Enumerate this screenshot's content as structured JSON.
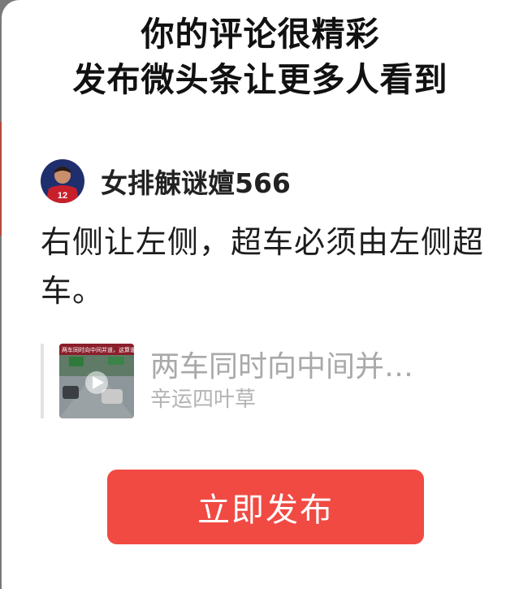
{
  "dialog": {
    "title_line1": "你的评论很精彩",
    "title_line2": "发布微头条让更多人看到"
  },
  "comment_card": {
    "username": "女排觫谜嬗566",
    "comment_text": "右侧让左侧，超车必须由左侧超车。",
    "avatar_jersey_number": "12"
  },
  "quoted_post": {
    "title": "两车同时向中间并…",
    "author": "辛运四叶草",
    "thumbnail_caption": "两车同时向中间并道，这算谁"
  },
  "actions": {
    "publish_label": "立即发布"
  },
  "colors": {
    "publish_button": "#f04a43",
    "dialog_background": "#ffffff",
    "muted_text": "#a9a9a9"
  }
}
